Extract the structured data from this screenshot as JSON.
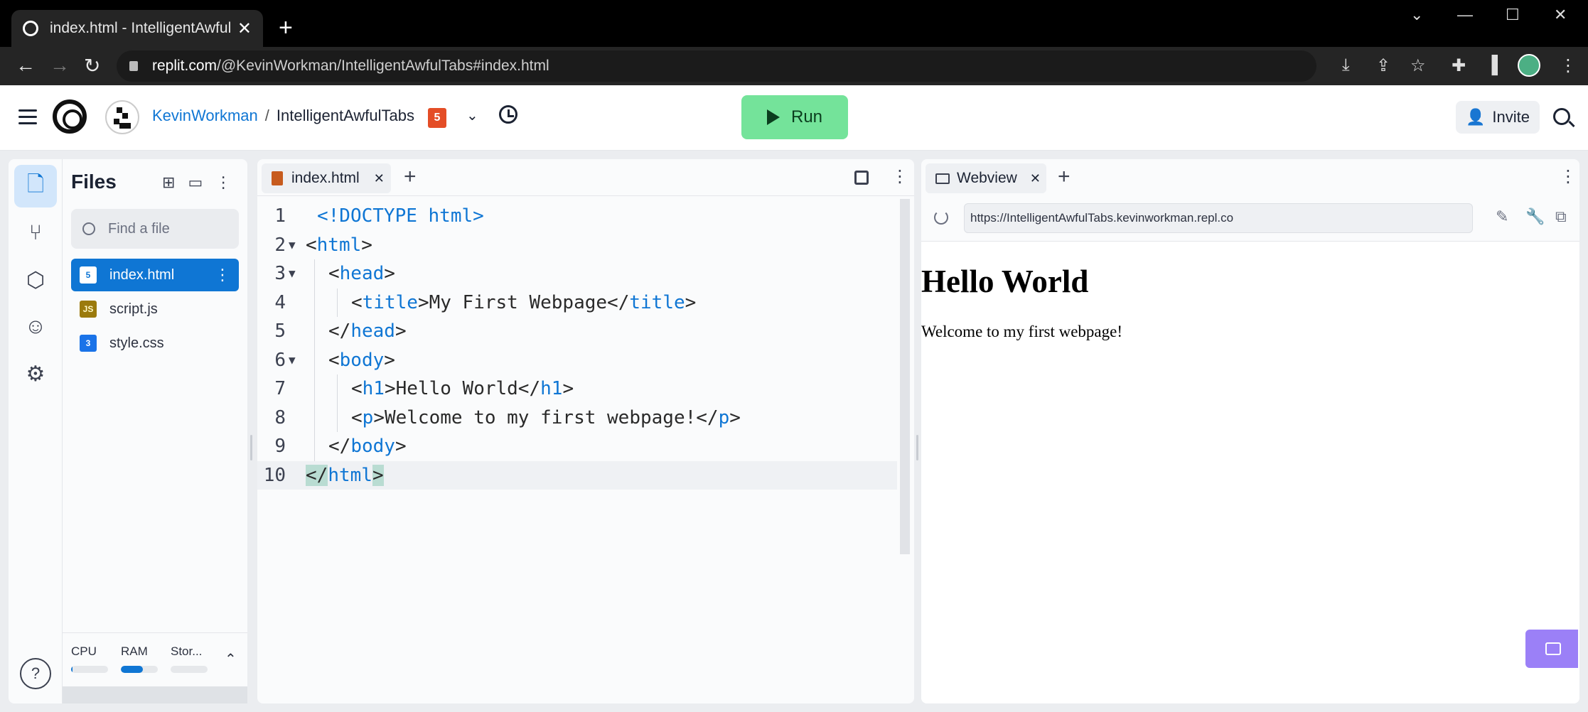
{
  "browser": {
    "tab_title": "index.html - IntelligentAwfulTabs",
    "new_tab": "+",
    "url_host": "replit.com",
    "url_path": "/@KevinWorkman/IntelligentAwfulTabs#index.html"
  },
  "header": {
    "username": "KevinWorkman",
    "separator": "/",
    "project": "IntelligentAwfulTabs",
    "badge": "5",
    "run_label": "Run",
    "invite_label": "Invite"
  },
  "files": {
    "title": "Files",
    "search_placeholder": "Find a file",
    "items": [
      {
        "name": "index.html",
        "type": "html",
        "icon": "html-file-icon",
        "selected": true
      },
      {
        "name": "script.js",
        "type": "js",
        "icon": "js-file-icon",
        "selected": false
      },
      {
        "name": "style.css",
        "type": "css",
        "icon": "css-file-icon",
        "selected": false
      }
    ],
    "resources": [
      {
        "label": "CPU",
        "level": 0.02
      },
      {
        "label": "RAM",
        "level": 0.6
      },
      {
        "label": "Stor...",
        "level": 0.0
      }
    ]
  },
  "editor": {
    "tab_label": "index.html",
    "lines": [
      {
        "n": "1",
        "fold": "",
        "indent": 0,
        "html": "<span class=\"t\">&lt;!DOCTYPE html&gt;</span>"
      },
      {
        "n": "2",
        "fold": "▼",
        "indent": 0,
        "html": "&lt;<span class=\"t\">html</span>&gt;"
      },
      {
        "n": "3",
        "fold": "▼",
        "indent": 1,
        "html": "&lt;<span class=\"t\">head</span>&gt;"
      },
      {
        "n": "4",
        "fold": "",
        "indent": 2,
        "html": "&lt;<span class=\"t\">title</span>&gt;My First Webpage&lt;/<span class=\"t\">title</span>&gt;"
      },
      {
        "n": "5",
        "fold": "",
        "indent": 1,
        "html": "&lt;/<span class=\"t\">head</span>&gt;"
      },
      {
        "n": "6",
        "fold": "▼",
        "indent": 1,
        "html": "&lt;<span class=\"t\">body</span>&gt;"
      },
      {
        "n": "7",
        "fold": "",
        "indent": 2,
        "html": "&lt;<span class=\"t\">h1</span>&gt;Hello World&lt;/<span class=\"t\">h1</span>&gt;"
      },
      {
        "n": "8",
        "fold": "",
        "indent": 2,
        "html": "&lt;<span class=\"t\">p</span>&gt;Welcome to my first webpage!&lt;/<span class=\"t\">p</span>&gt;"
      },
      {
        "n": "9",
        "fold": "",
        "indent": 1,
        "html": "&lt;/<span class=\"t\">body</span>&gt;"
      },
      {
        "n": "10",
        "fold": "",
        "indent": 0,
        "html": "<span class=\"hl\">&lt;/</span><span class=\"t\">html</span><span class=\"hl\">&gt;</span>",
        "current": true
      }
    ]
  },
  "webview": {
    "tab_label": "Webview",
    "url": "https://IntelligentAwfulTabs.kevinworkman.repl.co",
    "heading": "Hello World",
    "paragraph": "Welcome to my first webpage!"
  },
  "colors": {
    "accent": "#0f76d4",
    "run": "#74e39a",
    "chat": "#9b80f7"
  }
}
